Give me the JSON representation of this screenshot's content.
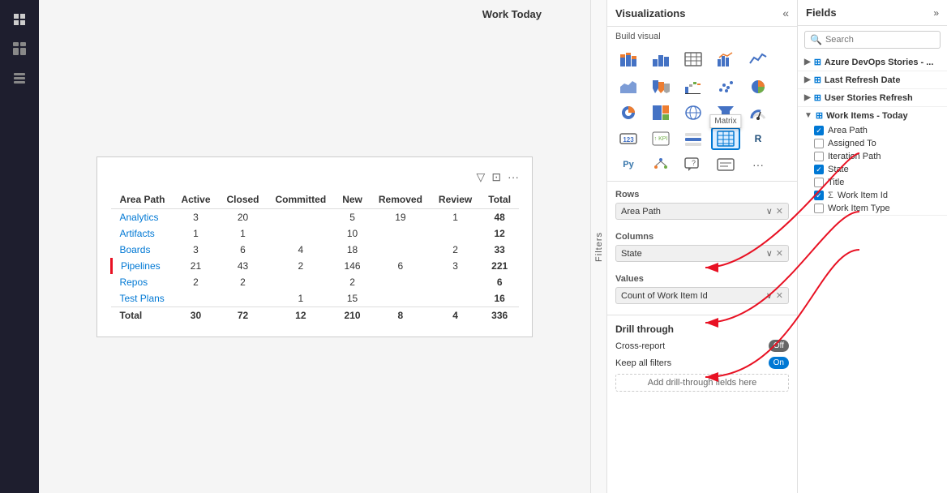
{
  "sidebar": {
    "icons": [
      {
        "name": "home-icon",
        "glyph": "⊞",
        "active": false
      },
      {
        "name": "grid-icon",
        "glyph": "⊞",
        "active": false
      },
      {
        "name": "layers-icon",
        "glyph": "❑",
        "active": false
      }
    ]
  },
  "canvas": {
    "work_today_label": "Work Today"
  },
  "matrix": {
    "columns": [
      "Area Path",
      "Active",
      "Closed",
      "Committed",
      "New",
      "Removed",
      "Review",
      "Total"
    ],
    "rows": [
      {
        "area": "Analytics",
        "active": "3",
        "closed": "20",
        "committed": "",
        "new": "5",
        "removed": "19",
        "review": "",
        "review2": "1",
        "total": "48",
        "highlight": false
      },
      {
        "area": "Artifacts",
        "active": "1",
        "closed": "1",
        "committed": "",
        "new": "10",
        "removed": "",
        "review": "",
        "review2": "",
        "total": "12",
        "highlight": false
      },
      {
        "area": "Boards",
        "active": "3",
        "closed": "6",
        "committed": "4",
        "new": "18",
        "removed": "",
        "review": "2",
        "review2": "",
        "total": "33",
        "highlight": false
      },
      {
        "area": "Pipelines",
        "active": "21",
        "closed": "43",
        "committed": "2",
        "new": "146",
        "removed": "6",
        "review": "3",
        "review2": "",
        "total": "221",
        "highlight": true
      },
      {
        "area": "Repos",
        "active": "2",
        "closed": "2",
        "committed": "",
        "new": "2",
        "removed": "",
        "review": "",
        "review2": "",
        "total": "6",
        "highlight": false
      },
      {
        "area": "Test Plans",
        "active": "",
        "closed": "",
        "committed": "1",
        "new": "15",
        "removed": "",
        "review": "",
        "review2": "",
        "total": "16",
        "highlight": false
      }
    ],
    "total_row": {
      "area": "Total",
      "active": "30",
      "closed": "72",
      "committed": "12",
      "new": "210",
      "removed": "8",
      "review": "4",
      "review2": "",
      "total": "336"
    }
  },
  "visualizations": {
    "panel_title": "Visualizations",
    "build_visual": "Build visual",
    "collapse_btn": "«",
    "viz_icons": [
      {
        "name": "stacked-bar-icon",
        "glyph": "▦"
      },
      {
        "name": "bar-chart-icon",
        "glyph": "📊"
      },
      {
        "name": "table-icon",
        "glyph": "⊞"
      },
      {
        "name": "line-bar-icon",
        "glyph": "📈"
      },
      {
        "name": "line-icon",
        "glyph": "〰"
      },
      {
        "name": "area-chart-icon",
        "glyph": "▲"
      },
      {
        "name": "ribbon-icon",
        "glyph": "🎗"
      },
      {
        "name": "waterfall-icon",
        "glyph": "║"
      },
      {
        "name": "scatter-icon",
        "glyph": "⁙"
      },
      {
        "name": "pie-icon",
        "glyph": "◕"
      },
      {
        "name": "donut-icon",
        "glyph": "◎"
      },
      {
        "name": "treemap-icon",
        "glyph": "▪"
      },
      {
        "name": "map-icon",
        "glyph": "🗺"
      },
      {
        "name": "funnel-icon",
        "glyph": "⬦"
      },
      {
        "name": "gauge-icon",
        "glyph": "◑"
      },
      {
        "name": "card-icon",
        "glyph": "▭"
      },
      {
        "name": "kpi-icon",
        "glyph": "↑"
      },
      {
        "name": "slicer-icon",
        "glyph": "≡"
      },
      {
        "name": "matrix-icon",
        "glyph": "⊞",
        "active": true
      },
      {
        "name": "r-icon",
        "glyph": "R"
      },
      {
        "name": "py-icon",
        "glyph": "Py"
      },
      {
        "name": "decomp-icon",
        "glyph": "⊛"
      },
      {
        "name": "qa-icon",
        "glyph": "💬"
      },
      {
        "name": "smart-icon",
        "glyph": "⊛"
      },
      {
        "name": "more-icon",
        "glyph": "···"
      }
    ],
    "matrix_tooltip": "Matrix",
    "rows_label": "Rows",
    "rows_field": "Area Path",
    "columns_label": "Columns",
    "columns_field": "State",
    "values_label": "Values",
    "values_field": "Count of Work Item Id",
    "drill_through": {
      "title": "Drill through",
      "cross_report_label": "Cross-report",
      "cross_report_toggle": "Off",
      "keep_filters_label": "Keep all filters",
      "keep_filters_toggle": "On",
      "add_field_label": "Add drill-through fields here"
    }
  },
  "fields": {
    "panel_title": "Fields",
    "expand_btn": "»",
    "search_placeholder": "Search",
    "groups": [
      {
        "name": "Azure DevOps Stories - ...",
        "icon": "table-group-icon",
        "expanded": false,
        "items": []
      },
      {
        "name": "Last Refresh Date",
        "icon": "table-group-icon",
        "expanded": false,
        "items": []
      },
      {
        "name": "User Stories Refresh",
        "icon": "table-group-icon",
        "expanded": false,
        "items": []
      },
      {
        "name": "Work Items - Today",
        "icon": "table-group-icon",
        "expanded": true,
        "items": [
          {
            "label": "Area Path",
            "checked": true,
            "sigma": false
          },
          {
            "label": "Assigned To",
            "checked": false,
            "sigma": false
          },
          {
            "label": "Iteration Path",
            "checked": false,
            "sigma": false
          },
          {
            "label": "State",
            "checked": true,
            "sigma": false
          },
          {
            "label": "Title",
            "checked": false,
            "sigma": false
          },
          {
            "label": "Work Item Id",
            "checked": true,
            "sigma": true
          },
          {
            "label": "Work Item Type",
            "checked": false,
            "sigma": false
          }
        ]
      }
    ]
  }
}
